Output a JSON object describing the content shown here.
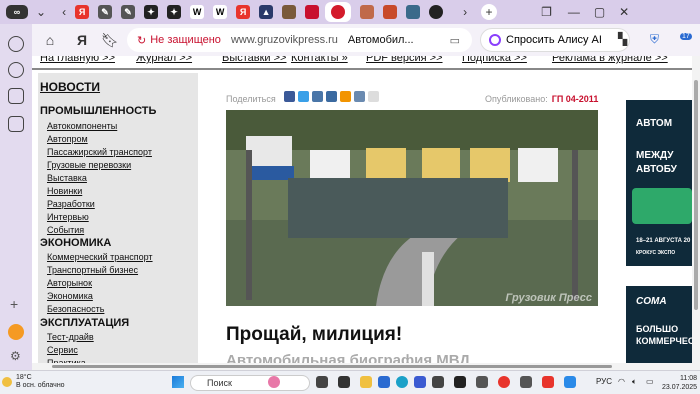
{
  "browser": {
    "address": {
      "security_warning": "Не защищено",
      "domain": "www.gruzovikpress.ru",
      "page_title": "Автомобил...",
      "alisa_button": "Спросить Алису АI"
    },
    "badge_count": "17"
  },
  "site": {
    "topnav": [
      "На главную >>",
      "Журнал >>",
      "Выставки >>",
      "Контакты »",
      "PDF версия >>",
      "Подписка >>",
      "Реклама в журнале >>"
    ],
    "sidebar": {
      "news": "НОВОСТИ",
      "sections": [
        {
          "title": "ПРОМЫШЛЕННОСТЬ",
          "items": [
            "Автокомпоненты",
            "Автопром",
            "Пассажирский транспорт",
            "Грузовые перевозки",
            "Выставка",
            "Новинки",
            "Разработки",
            "Интервью",
            "События"
          ]
        },
        {
          "title": "ЭКОНОМИКА",
          "items": [
            "Коммерческий транспорт",
            "Транспортный бизнес",
            "Авторынок",
            "Экономика",
            "Безопасность"
          ]
        },
        {
          "title": "ЭКСПЛУАТАЦИЯ",
          "items": [
            "Тест-драйв",
            "Сервис",
            "Практика"
          ]
        }
      ]
    },
    "article": {
      "share_label": "Поделиться",
      "published_label": "Опубликовано:",
      "issue": "ГП 04-2011",
      "watermark": "Грузовик Пресс",
      "headline": "Прощай, милиция!",
      "subheadline": "Автомобильная биография МВД"
    },
    "ads": {
      "ad1": [
        "АВТОМ",
        "МЕЖДУ",
        "АВТОБУ",
        "18–21 АВГУСТА 20",
        "КРОКУС ЭКСПО"
      ],
      "ad2": [
        "COMA",
        "БОЛЬШО",
        "КОММЕРЧЕС"
      ]
    }
  },
  "taskbar": {
    "weather_temp": "18°C",
    "weather_desc": "В осн. облачно",
    "search_placeholder": "Поиск",
    "lang": "РУС",
    "time": "11:08",
    "date": "23.07.2025"
  }
}
